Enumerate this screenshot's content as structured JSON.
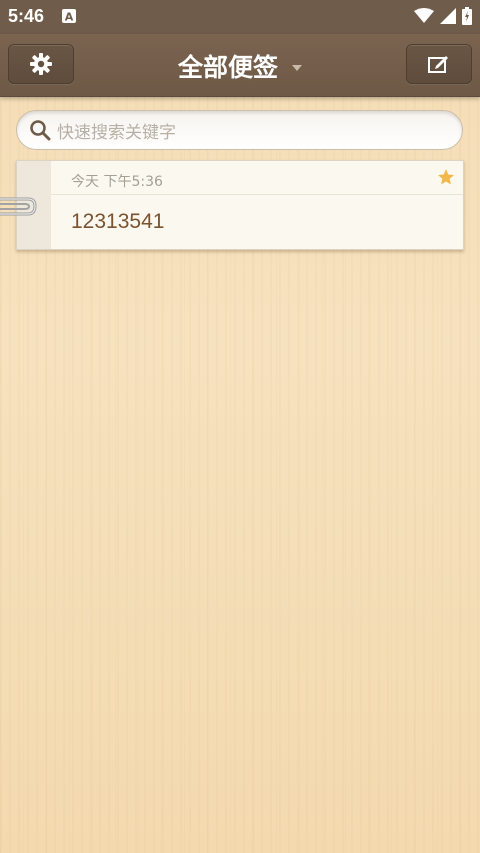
{
  "status_bar": {
    "time": "5:46",
    "icons": [
      "a-notification-icon",
      "wifi-icon",
      "signal-icon",
      "battery-icon"
    ]
  },
  "toolbar": {
    "title": "全部便签",
    "settings_icon": "gear-icon",
    "new_note_icon": "edit-icon"
  },
  "search": {
    "placeholder": "快速搜索关键字"
  },
  "notes": [
    {
      "date": "今天  下午5:36",
      "content": "12313541",
      "starred": true
    }
  ],
  "colors": {
    "toolbar": "#705c4a",
    "star": "#f0b94a",
    "note_text": "#7a5430"
  }
}
